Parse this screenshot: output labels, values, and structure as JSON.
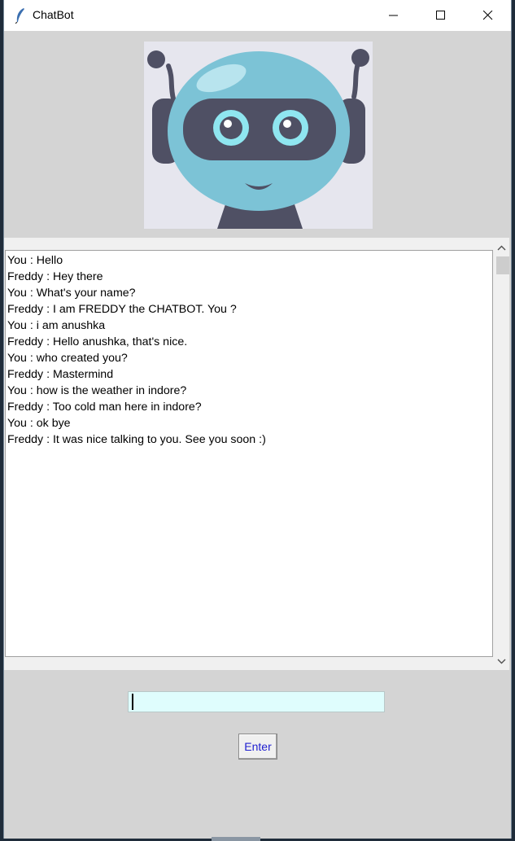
{
  "window": {
    "title": "ChatBot",
    "icon": "feather-icon"
  },
  "window_controls": {
    "minimize_icon": "minimize-icon",
    "maximize_icon": "maximize-icon",
    "close_icon": "close-icon"
  },
  "robot_image": {
    "icon": "robot-avatar",
    "colors": {
      "head": "#7cc3d6",
      "visor": "#4f5064",
      "eyes": "#8fe6f0",
      "background": "#e6e6ee"
    }
  },
  "chat": {
    "messages": [
      "You : Hello",
      "Freddy : Hey there",
      "You : What's your name?",
      "Freddy : I am FREDDY the CHATBOT.  You ?",
      "You : i am anushka",
      "Freddy : Hello anushka, that's nice.",
      "You : who created you?",
      "Freddy : Mastermind",
      "You : how is the weather in indore?",
      "Freddy : Too cold man here in indore?",
      "You : ok bye",
      "Freddy : It was nice talking to you. See you soon :)"
    ]
  },
  "input": {
    "value": "",
    "background": "#dffdfd"
  },
  "enter_button": {
    "label": "Enter",
    "text_color": "#1f1fd0"
  }
}
